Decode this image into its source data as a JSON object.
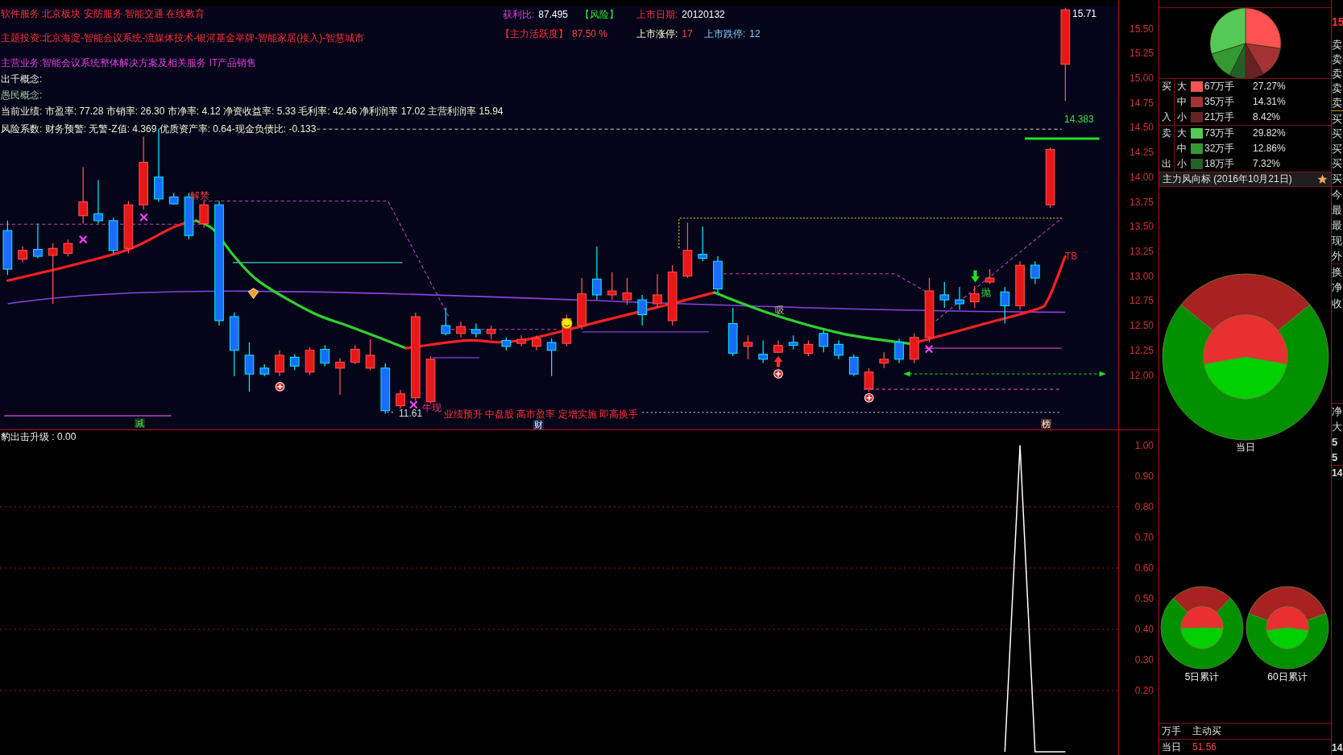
{
  "info_lines": [
    "软件服务 北京板块 安防服务 智能交通 在线教育",
    "主题投资:北京海淀-智能会议系统-流媒体技术-银河基金举牌-智能家居(接入)-智慧城市",
    "主营业务:智能会议系统整体解决方案及相关服务 IT产品销售",
    "出千概念:",
    "愚民概念:",
    "当前业绩: 市盈率: 77.28 市销率: 26.30 市净率: 4.12 净资收益率: 5.33 毛利率: 42.46 净利润率 17.02 主营利润率 15.94",
    "风险系数: 财务预警: 无警-Z值: 4.369 优质资产率: 0.64-现金负债比: -0.133"
  ],
  "stats": [
    {
      "label": "获利比:",
      "value": "87.495"
    },
    {
      "label": "【风险】"
    },
    {
      "label": "上市日期:",
      "value": "20120132"
    },
    {
      "label": "【主力活跃度】",
      "value": "87.50 %"
    },
    {
      "label": "上市涨停:",
      "value": "17"
    },
    {
      "label": "上市跌停:",
      "value": "12"
    }
  ],
  "chart_labels": [
    "15.71",
    "14.383",
    "11.61",
    "解禁",
    "牛现",
    "抛",
    "TB",
    "吸",
    "减",
    "业绩预升 中盘股 高市盈率 定增实施 即高换手",
    "财",
    "榜"
  ],
  "price_chart": {
    "chart_data": {
      "type": "candlestick",
      "categories": [
        null,
        null,
        null,
        null,
        null,
        null,
        null,
        null,
        null,
        null,
        null,
        null,
        null,
        null,
        null,
        null,
        null,
        null,
        null,
        null,
        null,
        null,
        null,
        null,
        null,
        null,
        null,
        null,
        null,
        null,
        null,
        null,
        null,
        null,
        null,
        null,
        null,
        null,
        null,
        null,
        null,
        null,
        null,
        null,
        null,
        null,
        null,
        null,
        null,
        null,
        null,
        null,
        null,
        null,
        null,
        null,
        null,
        null,
        null,
        null,
        null,
        null,
        null,
        null,
        null,
        null,
        null,
        null,
        null,
        null,
        null,
        null,
        null,
        null
      ],
      "ylim": [
        11.45,
        15.79
      ],
      "yticks": [
        {
          "value": 15.5,
          "label": "15.50"
        },
        {
          "value": 15.25,
          "label": "15.25"
        },
        {
          "value": 15,
          "label": "15.00"
        },
        {
          "value": 14.75,
          "label": "14.75"
        },
        {
          "value": 14.5,
          "label": "14.50"
        },
        {
          "value": 14.25,
          "label": "14.25"
        },
        {
          "value": 14,
          "label": "14.00"
        },
        {
          "value": 13.75,
          "label": "13.75"
        },
        {
          "value": 13.5,
          "label": "13.50"
        },
        {
          "value": 13.25,
          "label": "13.25"
        },
        {
          "value": 13,
          "label": "13.00"
        },
        {
          "value": 12.75,
          "label": "12.75"
        },
        {
          "value": 12.5,
          "label": "12.50"
        },
        {
          "value": 12.25,
          "label": "12.25"
        },
        {
          "value": 12,
          "label": "12.00"
        }
      ],
      "ohlc": [
        [
          13.46,
          13.56,
          13.01,
          13.07
        ],
        [
          13.17,
          13.3,
          13.14,
          13.26
        ],
        [
          13.27,
          13.53,
          13.18,
          13.2
        ],
        [
          13.21,
          13.33,
          12.72,
          13.28
        ],
        [
          13.23,
          13.37,
          13.2,
          13.33
        ],
        [
          13.61,
          14.1,
          13.53,
          13.75
        ],
        [
          13.63,
          13.97,
          13.53,
          13.56
        ],
        [
          13.56,
          13.59,
          13.23,
          13.26
        ],
        [
          13.28,
          13.76,
          13.23,
          13.72
        ],
        [
          13.72,
          14.41,
          13.67,
          14.15
        ],
        [
          14.0,
          14.49,
          13.75,
          13.78
        ],
        [
          13.8,
          13.84,
          13.72,
          13.73
        ],
        [
          13.8,
          13.84,
          13.37,
          13.41
        ],
        [
          13.53,
          13.75,
          13.49,
          13.72
        ],
        [
          13.72,
          13.76,
          12.5,
          12.55
        ],
        [
          12.59,
          12.63,
          11.99,
          12.25
        ],
        [
          12.2,
          12.33,
          11.83,
          12.01
        ],
        [
          12.07,
          12.11,
          11.99,
          12.01
        ],
        [
          12.03,
          12.25,
          11.99,
          12.2
        ],
        [
          12.18,
          12.21,
          12.05,
          12.09
        ],
        [
          12.03,
          12.28,
          12.0,
          12.25
        ],
        [
          12.26,
          12.3,
          12.09,
          12.12
        ],
        [
          12.07,
          12.17,
          11.8,
          12.13
        ],
        [
          12.13,
          12.3,
          12.11,
          12.26
        ],
        [
          12.07,
          12.36,
          12.05,
          12.2
        ],
        [
          12.07,
          12.12,
          11.61,
          11.64
        ],
        [
          11.69,
          11.85,
          11.66,
          11.81
        ],
        [
          11.77,
          12.63,
          11.74,
          12.59
        ],
        [
          11.73,
          12.19,
          11.71,
          12.16
        ],
        [
          12.5,
          12.68,
          12.4,
          12.42
        ],
        [
          12.42,
          12.54,
          12.38,
          12.49
        ],
        [
          12.46,
          12.52,
          12.38,
          12.42
        ],
        [
          12.42,
          12.5,
          12.36,
          12.46
        ],
        [
          12.35,
          12.38,
          12.25,
          12.29
        ],
        [
          12.32,
          12.4,
          12.29,
          12.36
        ],
        [
          12.29,
          12.4,
          12.25,
          12.37
        ],
        [
          12.33,
          12.37,
          11.99,
          12.25
        ],
        [
          12.32,
          12.61,
          12.29,
          12.57
        ],
        [
          12.5,
          12.98,
          12.46,
          12.82
        ],
        [
          12.97,
          13.3,
          12.76,
          12.81
        ],
        [
          12.81,
          13.04,
          12.76,
          12.85
        ],
        [
          12.76,
          12.98,
          12.71,
          12.83
        ],
        [
          12.76,
          12.81,
          12.5,
          12.61
        ],
        [
          12.72,
          13.02,
          12.68,
          12.81
        ],
        [
          12.55,
          13.11,
          12.5,
          13.04
        ],
        [
          13.0,
          13.54,
          12.98,
          13.26
        ],
        [
          13.22,
          13.5,
          13.15,
          13.18
        ],
        [
          13.15,
          13.2,
          12.83,
          12.87
        ],
        [
          12.52,
          12.68,
          12.19,
          12.22
        ],
        [
          12.29,
          12.4,
          12.16,
          12.33
        ],
        [
          12.21,
          12.35,
          12.12,
          12.16
        ],
        [
          12.23,
          12.35,
          12.22,
          12.3
        ],
        [
          12.33,
          12.4,
          12.26,
          12.3
        ],
        [
          12.22,
          12.35,
          12.19,
          12.31
        ],
        [
          12.42,
          12.46,
          12.23,
          12.29
        ],
        [
          12.31,
          12.35,
          12.16,
          12.2
        ],
        [
          12.18,
          12.21,
          11.99,
          12.01
        ],
        [
          11.86,
          12.07,
          11.83,
          12.03
        ],
        [
          12.12,
          12.23,
          12.07,
          12.16
        ],
        [
          12.33,
          12.37,
          12.12,
          12.16
        ],
        [
          12.16,
          12.42,
          12.12,
          12.38
        ],
        [
          12.38,
          12.98,
          12.33,
          12.85
        ],
        [
          12.81,
          12.94,
          12.68,
          12.76
        ],
        [
          12.76,
          12.89,
          12.66,
          12.72
        ],
        [
          12.74,
          12.9,
          12.68,
          12.82
        ],
        [
          12.94,
          13.07,
          12.92,
          12.98
        ],
        [
          12.84,
          12.89,
          12.52,
          12.7
        ],
        [
          12.7,
          13.15,
          12.66,
          13.11
        ],
        [
          13.11,
          13.15,
          12.92,
          12.98
        ],
        [
          13.72,
          14.3,
          13.69,
          14.28
        ],
        [
          15.14,
          15.71,
          14.77,
          15.69
        ],
        null,
        null,
        null
      ]
    }
  },
  "indicator": {
    "chart_data": {
      "type": "line",
      "title": "豹出击升级 : 0.00",
      "categories": [
        null,
        null,
        null,
        null,
        null,
        null,
        null,
        null,
        null,
        null,
        null,
        null,
        null,
        null,
        null,
        null,
        null,
        null,
        null,
        null,
        null,
        null,
        null,
        null,
        null,
        null,
        null,
        null,
        null,
        null,
        null,
        null,
        null,
        null,
        null,
        null,
        null,
        null,
        null,
        null,
        null,
        null,
        null,
        null,
        null,
        null,
        null,
        null,
        null,
        null,
        null,
        null,
        null,
        null,
        null,
        null,
        null,
        null,
        null,
        null,
        null,
        null,
        null,
        null,
        null,
        null,
        null,
        null,
        null,
        null,
        null,
        null,
        null,
        null
      ],
      "ylim": [
        0,
        1.05
      ],
      "grid": true,
      "series": [
        {
          "color": "#ffffff",
          "values": [
            null,
            null,
            null,
            null,
            null,
            null,
            null,
            null,
            null,
            null,
            null,
            null,
            null,
            null,
            null,
            null,
            null,
            null,
            null,
            null,
            null,
            null,
            null,
            null,
            null,
            null,
            null,
            null,
            null,
            null,
            null,
            null,
            null,
            null,
            null,
            null,
            null,
            null,
            null,
            null,
            null,
            null,
            null,
            null,
            null,
            null,
            null,
            null,
            null,
            null,
            null,
            null,
            null,
            null,
            null,
            null,
            null,
            null,
            null,
            null,
            null,
            null,
            null,
            null,
            null,
            null,
            0,
            1,
            0,
            0,
            0,
            null,
            null,
            null
          ]
        }
      ],
      "yticks": [
        {
          "value": 1,
          "label": "1.00"
        },
        {
          "value": 0.9,
          "label": "0.90"
        },
        {
          "value": 0.8,
          "label": "0.80"
        },
        {
          "value": 0.7,
          "label": "0.70"
        },
        {
          "value": 0.6,
          "label": "0.60"
        },
        {
          "value": 0.5,
          "label": "0.50"
        },
        {
          "value": 0.4,
          "label": "0.40"
        },
        {
          "value": 0.3,
          "label": "0.30"
        },
        {
          "value": 0.2,
          "label": "0.20"
        }
      ]
    }
  },
  "flow": {
    "chart_data": {
      "type": "pie",
      "values": [
        27.27,
        14.31,
        8.42,
        29.82,
        12.86,
        7.32
      ]
    },
    "groups": [
      {
        "side_top": "买",
        "side_bottom": "入",
        "rows": [
          {
            "size": "大",
            "color": "#ff5252",
            "amount": "67万手",
            "percent": "27.27%"
          },
          {
            "size": "中",
            "color": "#a33333",
            "amount": "35万手",
            "percent": "14.31%"
          },
          {
            "size": "小",
            "color": "#662222",
            "amount": "21万手",
            "percent": "8.42%"
          }
        ]
      },
      {
        "side_top": "卖",
        "side_bottom": "出",
        "rows": [
          {
            "size": "大",
            "color": "#55c855",
            "amount": "73万手",
            "percent": "29.82%"
          },
          {
            "size": "中",
            "color": "#339933",
            "amount": "32万手",
            "percent": "12.86%"
          },
          {
            "size": "小",
            "color": "#22602a",
            "amount": "18万手",
            "percent": "7.32%"
          }
        ]
      }
    ],
    "wind_title": "主力风向标 (2016年10月21日)"
  },
  "daily_donut": {
    "label": "当日"
  },
  "cumulative_donuts": [
    {
      "label": "5日累计"
    },
    {
      "label": "60日累计"
    }
  ],
  "bottom_rows": [
    [
      "万手",
      "主动买"
    ],
    [
      "当日",
      "51.56"
    ]
  ],
  "edge_column": [
    [
      "15"
    ],
    [
      "卖",
      "卖",
      "卖",
      "卖",
      "卖"
    ],
    [
      "买",
      "买",
      "买",
      "买",
      "买"
    ],
    [
      "今",
      "最",
      "最",
      "现",
      "外"
    ],
    [
      "换",
      "净",
      "收"
    ],
    [
      "净",
      "大",
      "5",
      "5"
    ],
    [
      "14"
    ],
    [
      "14"
    ]
  ]
}
